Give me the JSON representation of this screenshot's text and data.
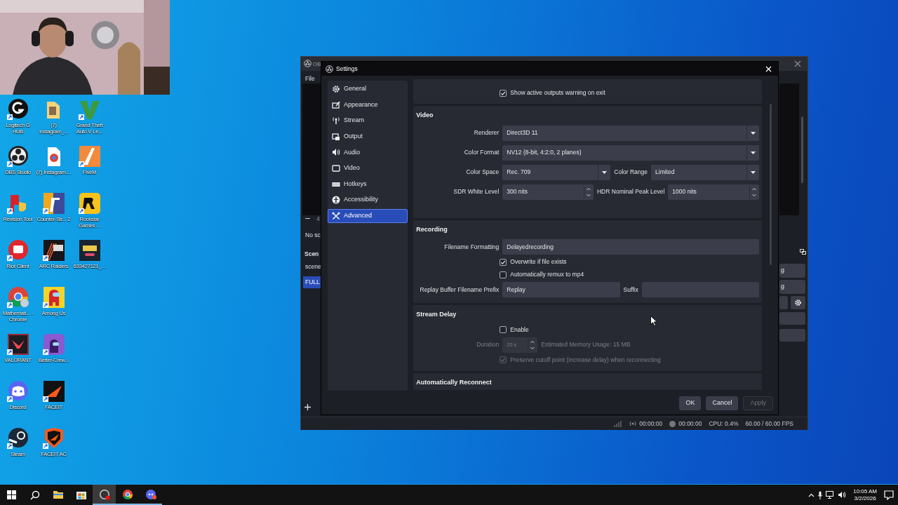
{
  "webcam": {
    "kind": "picture"
  },
  "desktop_rows": [
    [
      {
        "label": "Logitech G HUB"
      },
      {
        "label": "(7) Instagram_..."
      },
      {
        "label": "Grand Theft Auto V Le..."
      }
    ],
    [
      {
        "label": "OBS Studio"
      },
      {
        "label": "(7) Instagram...."
      },
      {
        "label": "FiveM"
      }
    ],
    [
      {
        "label": "Revision Tool"
      },
      {
        "label": "Counter-Str... 2"
      },
      {
        "label": "Rockstar Games ..."
      }
    ],
    [
      {
        "label": "Riot Client"
      },
      {
        "label": "ARC Raiders"
      },
      {
        "label": "633427121_..."
      }
    ],
    [
      {
        "label": "Mathemati... - Chrome"
      },
      {
        "label": "Among Us"
      }
    ],
    [
      {
        "label": "VALORANT"
      },
      {
        "label": "Better-Crew..."
      }
    ],
    [
      {
        "label": "Discord"
      },
      {
        "label": "FACEIT"
      }
    ],
    [
      {
        "label": "Steam"
      },
      {
        "label": "FACEIT AC"
      }
    ]
  ],
  "obs_main": {
    "title": "OB",
    "menu": [
      "File"
    ],
    "preview_zoom": "4",
    "preview_note": "No sc",
    "scenes_title": "Scen",
    "scenes": [
      {
        "label": "scene",
        "selected": false
      },
      {
        "label": "FULL",
        "selected": true
      }
    ],
    "controls": [
      {
        "label": "g"
      },
      {
        "label": "g"
      }
    ],
    "status": {
      "stream_time": "00:00:00",
      "record_time": "00:00:00",
      "cpu": "CPU: 0.4%",
      "fps": "60.00 / 60.00 FPS"
    }
  },
  "settings": {
    "title": "Settings",
    "nav": [
      {
        "label": "General",
        "selected": false
      },
      {
        "label": "Appearance",
        "selected": false
      },
      {
        "label": "Stream",
        "selected": false
      },
      {
        "label": "Output",
        "selected": false
      },
      {
        "label": "Audio",
        "selected": false
      },
      {
        "label": "Video",
        "selected": false
      },
      {
        "label": "Hotkeys",
        "selected": false
      },
      {
        "label": "Accessibility",
        "selected": false
      },
      {
        "label": "Advanced",
        "selected": true
      }
    ],
    "sections": [
      {
        "rows": [
          {
            "kind": "checkbox",
            "label": "Show active outputs warning on exit",
            "checked": true,
            "disabled": false
          }
        ]
      },
      {
        "title": "Video",
        "rows": [
          {
            "kind": "fields",
            "disabled": false,
            "fields": [
              {
                "kind": "select",
                "label": "Renderer",
                "value": "Direct3D 11"
              }
            ]
          },
          {
            "kind": "fields",
            "disabled": false,
            "fields": [
              {
                "kind": "select",
                "label": "Color Format",
                "value": "NV12 (8-bit, 4:2:0, 2 planes)"
              }
            ]
          },
          {
            "kind": "fields",
            "disabled": false,
            "fields": [
              {
                "kind": "select",
                "label": "Color Space",
                "value": "Rec. 709"
              },
              {
                "kind": "select",
                "label": "Color Range",
                "value": "Limited"
              }
            ]
          },
          {
            "kind": "fields",
            "disabled": false,
            "fields": [
              {
                "kind": "spin",
                "label": "SDR White Level",
                "value": "300 nits"
              },
              {
                "kind": "spin",
                "label": "HDR Nominal Peak Level",
                "value": "1000 nits"
              }
            ]
          }
        ]
      },
      {
        "title": "Recording",
        "rows": [
          {
            "kind": "fields",
            "disabled": false,
            "fields": [
              {
                "kind": "text",
                "label": "Filename Formatting",
                "value": "Delayedrecording"
              }
            ]
          },
          {
            "kind": "checkbox",
            "label": "Overwrite if file exists",
            "checked": true,
            "disabled": false
          },
          {
            "kind": "checkbox",
            "label": "Automatically remux to mp4",
            "checked": false,
            "disabled": false
          },
          {
            "kind": "fields",
            "disabled": false,
            "fields": [
              {
                "kind": "text",
                "label": "Replay Buffer Filename Prefix",
                "value": "Replay"
              },
              {
                "kind": "text",
                "label": "Suffix"
              }
            ]
          }
        ]
      },
      {
        "title": "Stream Delay",
        "rows": [
          {
            "kind": "checkbox",
            "label": "Enable",
            "checked": false,
            "disabled": false
          },
          {
            "kind": "fields",
            "disabled": true,
            "fields": [
              {
                "kind": "spin",
                "label": "Duration",
                "value": "20 s"
              },
              {
                "kind": "note",
                "value": "Estimated Memory Usage: 15 MB"
              }
            ]
          },
          {
            "kind": "checkbox",
            "label": "Preserve cutoff point (increase delay) when reconnecting",
            "checked": true,
            "disabled": true
          }
        ]
      },
      {
        "title": "Automatically Reconnect"
      }
    ],
    "buttons": [
      {
        "label": "OK",
        "disabled": false
      },
      {
        "label": "Cancel",
        "disabled": false
      },
      {
        "label": "Apply",
        "disabled": true
      }
    ]
  },
  "taskbar": {
    "apps": [
      {
        "selected": false,
        "running": false
      },
      {
        "selected": false,
        "running": false
      },
      {
        "selected": true,
        "running": true
      },
      {
        "selected": false,
        "running": true
      },
      {
        "selected": false,
        "running": true
      }
    ],
    "time": "10:05 AM",
    "date": "3/2/2026"
  }
}
